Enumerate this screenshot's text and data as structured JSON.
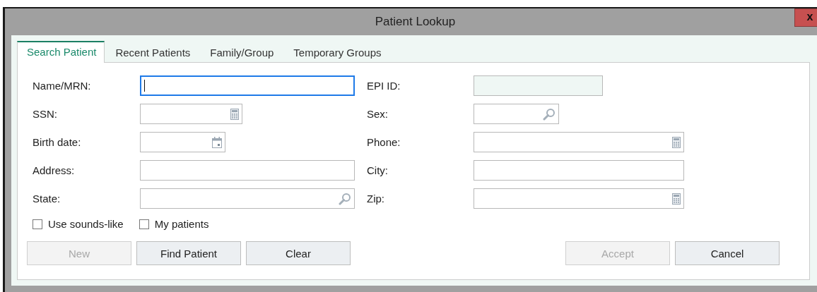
{
  "window": {
    "title": "Patient Lookup",
    "close_label": "x"
  },
  "tabs": [
    {
      "label": "Search Patient",
      "selected": true
    },
    {
      "label": "Recent Patients",
      "selected": false
    },
    {
      "label": "Family/Group",
      "selected": false
    },
    {
      "label": "Temporary Groups",
      "selected": false
    }
  ],
  "fields": [
    {
      "label": "Name/MRN:",
      "kind": "text",
      "focused": true,
      "disabled": false
    },
    {
      "label": "EPI ID:",
      "kind": "text",
      "focused": false,
      "disabled": true
    },
    {
      "label": "SSN:",
      "kind": "calculator",
      "focused": false,
      "disabled": false
    },
    {
      "label": "Sex:",
      "kind": "lookup",
      "focused": false,
      "disabled": false
    },
    {
      "label": "Birth date:",
      "kind": "date",
      "focused": false,
      "disabled": false
    },
    {
      "label": "Phone:",
      "kind": "calculator",
      "focused": false,
      "disabled": false
    },
    {
      "label": "Address:",
      "kind": "text",
      "focused": false,
      "disabled": false
    },
    {
      "label": "City:",
      "kind": "text",
      "focused": false,
      "disabled": false
    },
    {
      "label": "State:",
      "kind": "lookup",
      "focused": false,
      "disabled": false
    },
    {
      "label": "Zip:",
      "kind": "calculator",
      "focused": false,
      "disabled": false
    }
  ],
  "checkboxes": [
    {
      "label": "Use sounds-like",
      "checked": false
    },
    {
      "label": "My patients",
      "checked": false
    }
  ],
  "left_buttons": [
    {
      "label": "New",
      "disabled": true
    },
    {
      "label": "Find Patient",
      "disabled": false
    },
    {
      "label": "Clear",
      "disabled": false
    }
  ],
  "right_buttons": [
    {
      "label": "Accept",
      "disabled": true
    },
    {
      "label": "Cancel",
      "disabled": false
    }
  ]
}
